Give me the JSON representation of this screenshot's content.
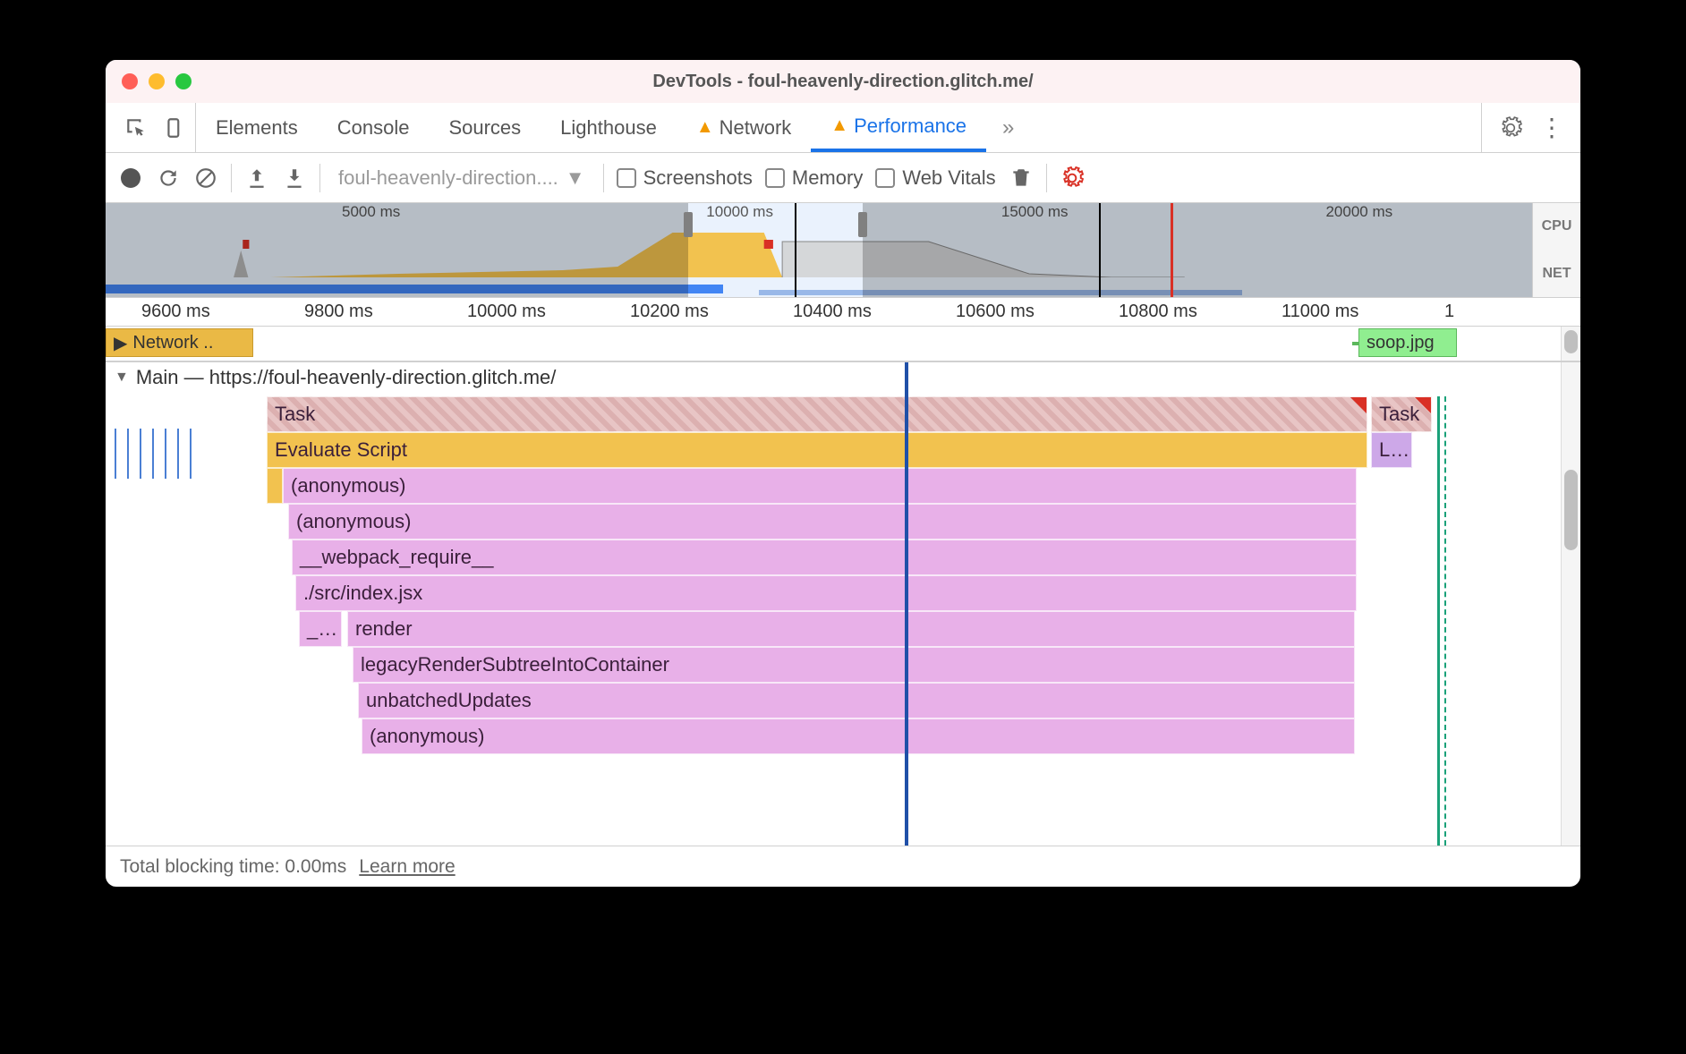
{
  "window": {
    "title": "DevTools - foul-heavenly-direction.glitch.me/"
  },
  "tabs": {
    "elements": "Elements",
    "console": "Console",
    "sources": "Sources",
    "lighthouse": "Lighthouse",
    "network": "Network",
    "performance": "Performance",
    "more": "»"
  },
  "toolbar": {
    "url": "foul-heavenly-direction....",
    "screenshots": "Screenshots",
    "memory": "Memory",
    "web_vitals": "Web Vitals"
  },
  "overview": {
    "ticks": [
      "5000 ms",
      "10000 ms",
      "15000 ms",
      "20000 ms"
    ],
    "side_cpu": "CPU",
    "side_net": "NET"
  },
  "ruler": {
    "ticks": [
      "9600 ms",
      "9800 ms",
      "10000 ms",
      "10200 ms",
      "10400 ms",
      "10600 ms",
      "10800 ms",
      "11000 ms",
      "1"
    ]
  },
  "network_track": {
    "label": "Network ..",
    "file": "soop.jpg"
  },
  "main": {
    "header": "Main — https://foul-heavenly-direction.glitch.me/",
    "rows": {
      "task1": "Task",
      "task2": "Task",
      "eval": "Evaluate Script",
      "l": "L…",
      "anon1": "(anonymous)",
      "anon2": "(anonymous)",
      "webpack": "__webpack_require__",
      "index": "./src/index.jsx",
      "dashrow": "_…",
      "render": "render",
      "legacy": "legacyRenderSubtreeIntoContainer",
      "unbatched": "unbatchedUpdates",
      "anon3": "(anonymous)"
    }
  },
  "footer": {
    "tbt": "Total blocking time: 0.00ms",
    "learn": "Learn more"
  }
}
